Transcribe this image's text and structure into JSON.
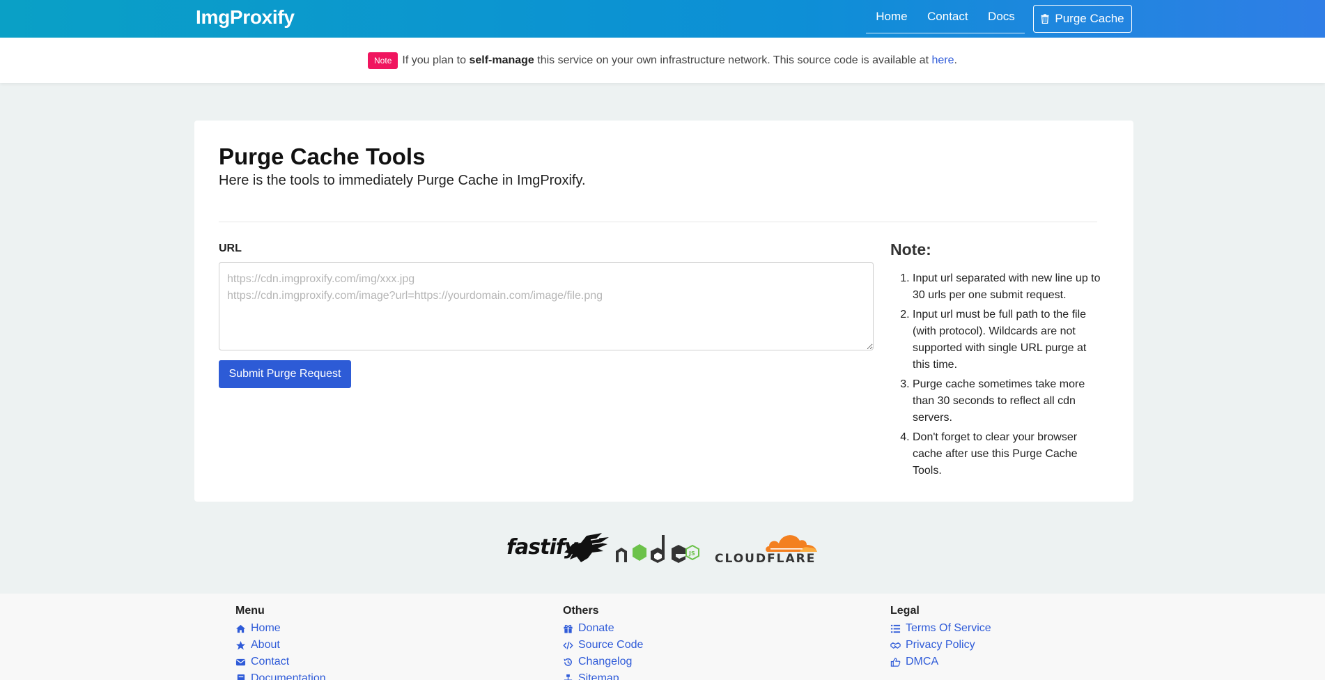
{
  "navbar": {
    "brand": "ImgProxify",
    "links": [
      "Home",
      "Contact",
      "Docs"
    ],
    "purge_button": "Purge Cache"
  },
  "notice": {
    "tag": "Note",
    "text_before": "If you plan to",
    "bold": "self-manage",
    "text_after": "this service on your own infrastructure network. This source code is available at",
    "link": "here",
    "end": "."
  },
  "main": {
    "title": "Purge Cache Tools",
    "subtitle": "Here is the tools to immediately Purge Cache in ImgProxify.",
    "url_label": "URL",
    "url_value": "",
    "url_placeholder": "https://cdn.imgproxify.com/img/xxx.jpg\nhttps://cdn.imgproxify.com/image?url=https://yourdomain.com/image/file.png",
    "submit_label": "Submit Purge Request",
    "note_title": "Note:",
    "notes": [
      "Input url separated with new line up to 30 urls per one submit request.",
      "Input url must be full path to the file (with protocol). Wildcards are not supported with single URL purge at this time.",
      "Purge cache sometimes take more than 30 seconds to reflect all cdn servers.",
      "Don't forget to clear your browser cache after use this Purge Cache Tools."
    ]
  },
  "logos": {
    "fastify": "fastify",
    "cloudflare": "CLOUDFLARE"
  },
  "footer": {
    "menu": {
      "title": "Menu",
      "items": [
        "Home",
        "About",
        "Contact",
        "Documentation"
      ]
    },
    "others": {
      "title": "Others",
      "items": [
        "Donate",
        "Source Code",
        "Changelog",
        "Sitemap"
      ]
    },
    "legal": {
      "title": "Legal",
      "items": [
        "Terms Of Service",
        "Privacy Policy",
        "DMCA"
      ]
    }
  },
  "colors": {
    "primary": "#2d5bd6",
    "note_tag": "#f0155f",
    "nav_gradient_start": "#0aa0c6",
    "nav_gradient_end": "#2f7ee6",
    "cloudflare_orange": "#f38020",
    "node_green": "#6cc24a"
  }
}
